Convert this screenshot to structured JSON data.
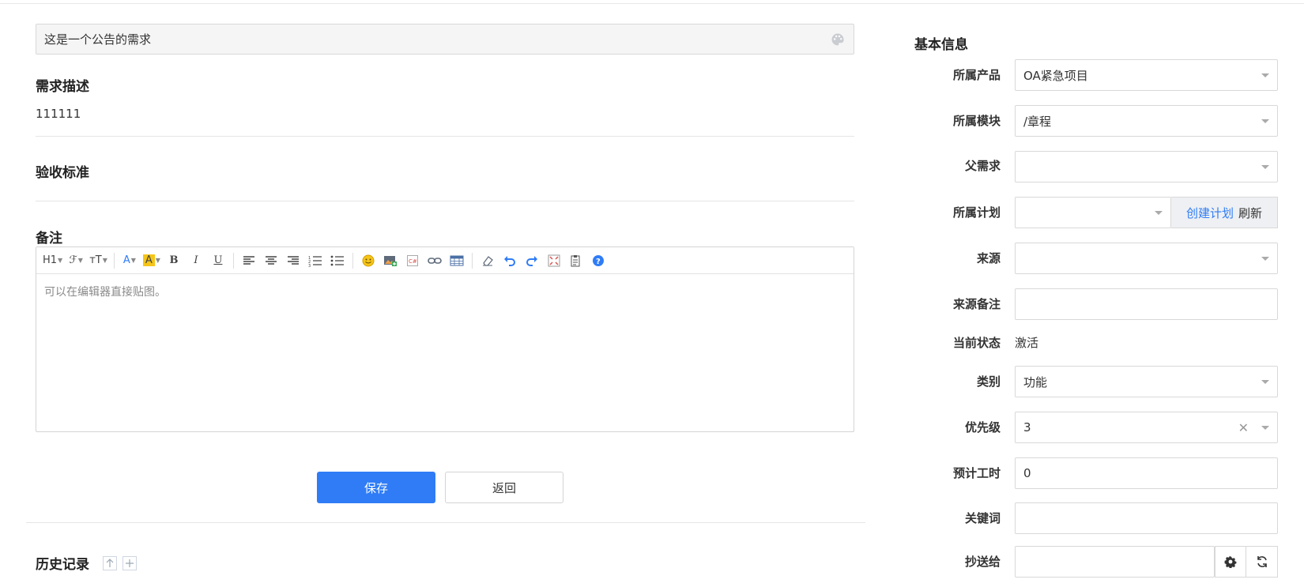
{
  "story": {
    "title": "这是一个公告的需求",
    "description_label": "需求描述",
    "description_value": "111111",
    "acceptance_label": "验收标准",
    "remark_label": "备注",
    "editor_placeholder": "可以在编辑器直接贴图。",
    "toolbar": {
      "heading": "H1",
      "font": "ℱ",
      "size": "тT",
      "text_color": "A",
      "bg_color": "A",
      "bold": "B",
      "italic": "I",
      "underline": "U"
    }
  },
  "actions": {
    "save": "保存",
    "back": "返回"
  },
  "history": {
    "title": "历史记录"
  },
  "sidebar": {
    "title": "基本信息",
    "product_label": "所属产品",
    "product_value": "OA紧急项目",
    "module_label": "所属模块",
    "module_value": "/章程",
    "parent_label": "父需求",
    "parent_value": "",
    "plan_label": "所属计划",
    "plan_value": "",
    "create_plan": "创建计划",
    "refresh": "刷新",
    "source_label": "来源",
    "source_value": "",
    "source_note_label": "来源备注",
    "source_note_value": "",
    "status_label": "当前状态",
    "status_value": "激活",
    "category_label": "类别",
    "category_value": "功能",
    "priority_label": "优先级",
    "priority_value": "3",
    "estimate_label": "预计工时",
    "estimate_value": "0",
    "keywords_label": "关键词",
    "keywords_value": "",
    "cc_label": "抄送给",
    "cc_value": ""
  },
  "colors": {
    "primary": "#2f7cf6",
    "border": "#d8d8d8",
    "text": "#333333"
  }
}
